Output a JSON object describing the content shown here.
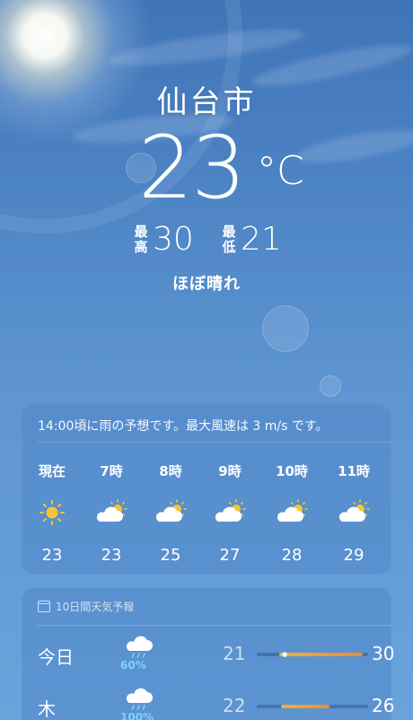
{
  "location": {
    "city": "仙台市"
  },
  "current": {
    "temperature": "23",
    "unit": "°C",
    "high_label": "最高",
    "high": "30",
    "low_label": "最低",
    "low": "21",
    "condition": "ほぼ晴れ"
  },
  "hourly": {
    "note": "14:00頃に雨の予想です。最大風速は 3 m/s です。",
    "items": [
      {
        "label": "現在",
        "icon": "sun-icon",
        "temp": "23"
      },
      {
        "label": "7時",
        "icon": "partly-cloudy-icon",
        "temp": "23"
      },
      {
        "label": "8時",
        "icon": "partly-cloudy-icon",
        "temp": "25"
      },
      {
        "label": "9時",
        "icon": "partly-cloudy-icon",
        "temp": "27"
      },
      {
        "label": "10時",
        "icon": "partly-cloudy-icon",
        "temp": "28"
      },
      {
        "label": "11時",
        "icon": "partly-cloudy-icon",
        "temp": "29"
      }
    ]
  },
  "daily": {
    "header": "10日間天気予報",
    "days": [
      {
        "day": "今日",
        "icon": "rain-cloud-icon",
        "precip": "60%",
        "low": "21",
        "high": "30",
        "range_start": 0.2,
        "range_end": 0.95,
        "current": 0.25
      },
      {
        "day": "木",
        "icon": "rain-cloud-icon",
        "precip": "100%",
        "low": "22",
        "high": "26",
        "range_start": 0.22,
        "range_end": 0.65
      }
    ]
  },
  "colors": {
    "sky_top": "#3f74b8",
    "card": "#5087c8",
    "precip": "#7fd3ff",
    "sun": "#f6c531",
    "range_bar": "#f08a2e"
  }
}
